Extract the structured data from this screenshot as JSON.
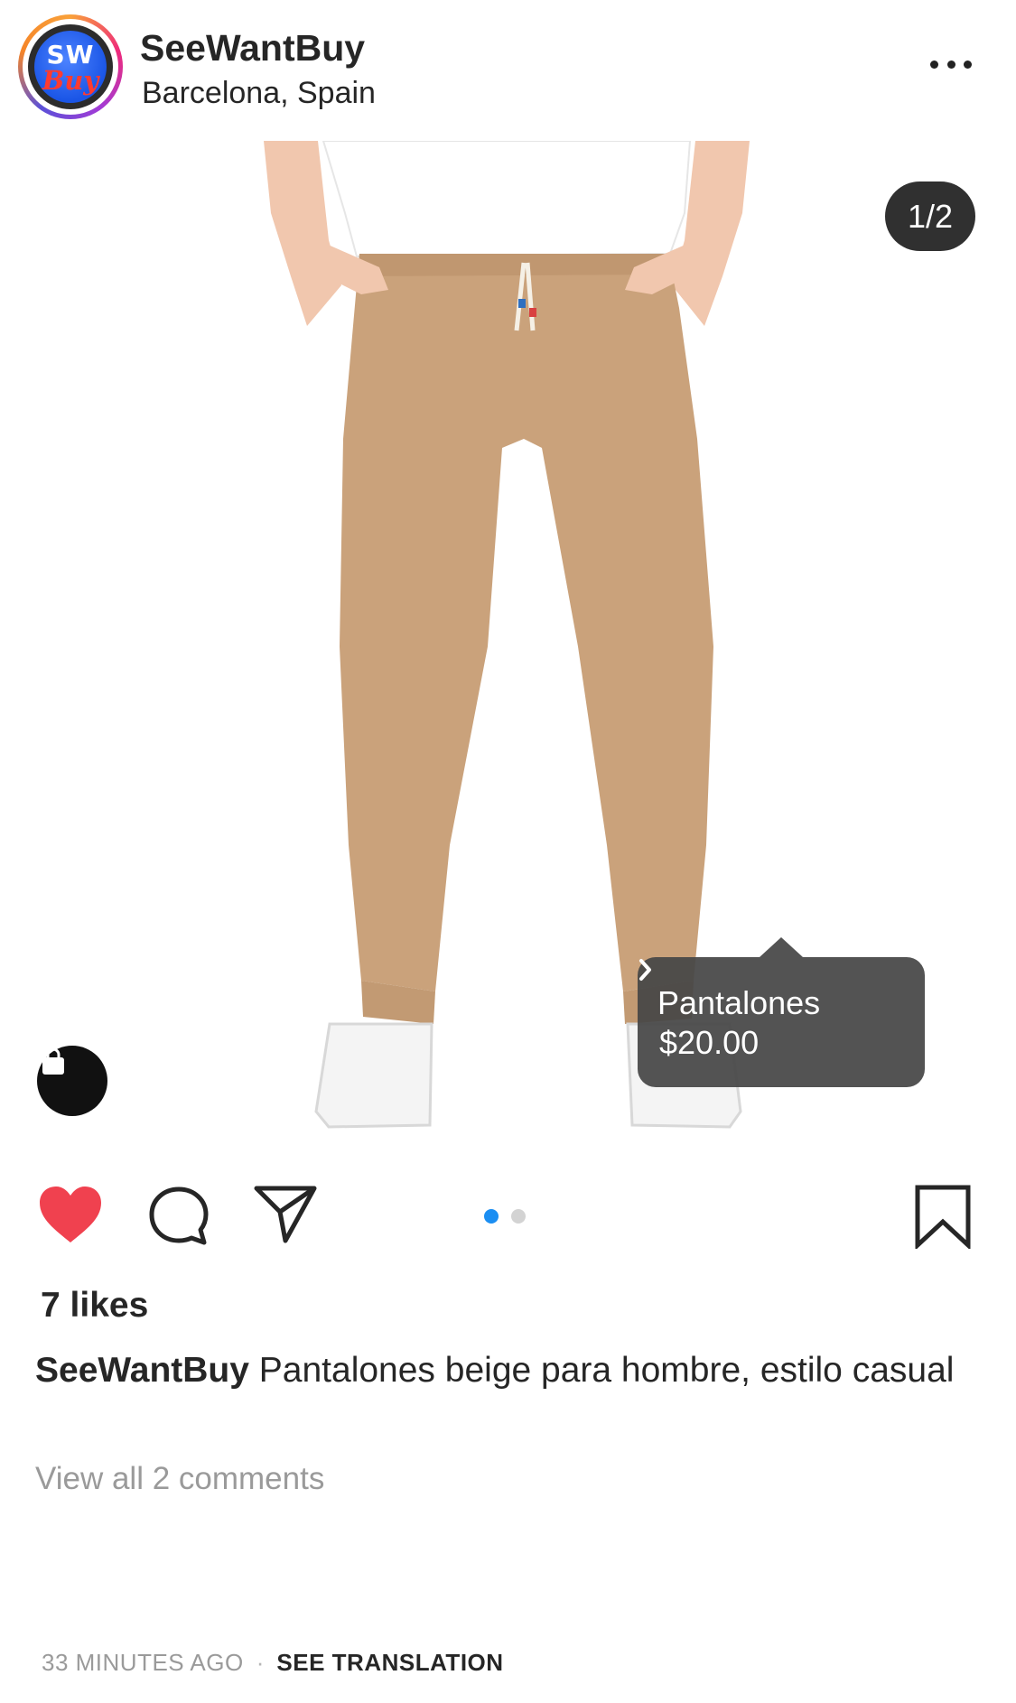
{
  "post": {
    "account_name": "SeeWantBuy",
    "location": "Barcelona, Spain",
    "avatar_logo_top": "SW",
    "avatar_logo_bottom": "Buy",
    "more_icon": "more-horizontal-icon",
    "image_counter": "1/2",
    "product_tag": {
      "name": "Pantalones",
      "price": "$20.00",
      "chevron_icon": "chevron-right-icon"
    },
    "shop_icon": "shopping-bag-icon",
    "carousel": {
      "total": 2,
      "active_index": 0,
      "active_color": "#1b8ef2",
      "inactive_color": "#d3d3d3"
    },
    "actions": {
      "like_icon": "heart-icon",
      "liked": true,
      "like_color": "#f0414f",
      "comment_icon": "comment-icon",
      "share_icon": "share-icon",
      "bookmark_icon": "bookmark-icon"
    },
    "likes": "7 likes",
    "caption_user": "SeeWantBuy",
    "caption_text": "Pantalones beige para hombre, estilo casual",
    "view_comments": "View all 2 comments",
    "timestamp": "33 MINUTES AGO",
    "separator": "·",
    "see_translation": "SEE TRANSLATION"
  }
}
